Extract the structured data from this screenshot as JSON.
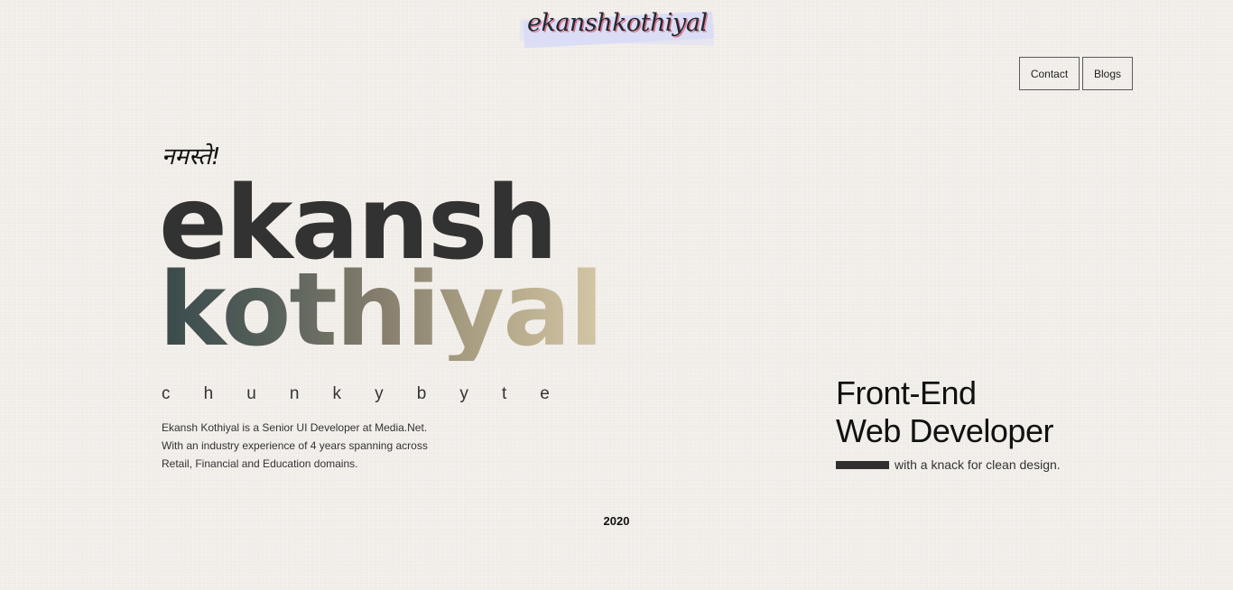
{
  "header": {
    "logo_text": "ekanshkothiyal",
    "nav": {
      "contact_label": "Contact",
      "blogs_label": "Blogs"
    }
  },
  "hero": {
    "greeting": "नमस्ते!",
    "first_name": "ekansh",
    "last_name": "kothiyal",
    "handle_letters": [
      "c",
      "h",
      "u",
      "n",
      "k",
      "y",
      "b",
      "y",
      "t",
      "e"
    ],
    "bio_lines": [
      "Ekansh Kothiyal is a Senior UI Developer at Media.Net.",
      "With an industry experience of 4 years spanning across",
      "Retail, Financial and Education domains."
    ]
  },
  "role": {
    "line1": "Front-End",
    "line2": "Web Developer",
    "tagline": "with a knack for clean design."
  },
  "footer": {
    "year": "2020"
  },
  "colors": {
    "background": "#f3efeb",
    "text_dark": "#333232",
    "logo_highlight": "#d9dcf6",
    "logo_shadow": "#e07a8a",
    "gradient_start": "#394a4c",
    "gradient_end": "#d4c7a6"
  }
}
